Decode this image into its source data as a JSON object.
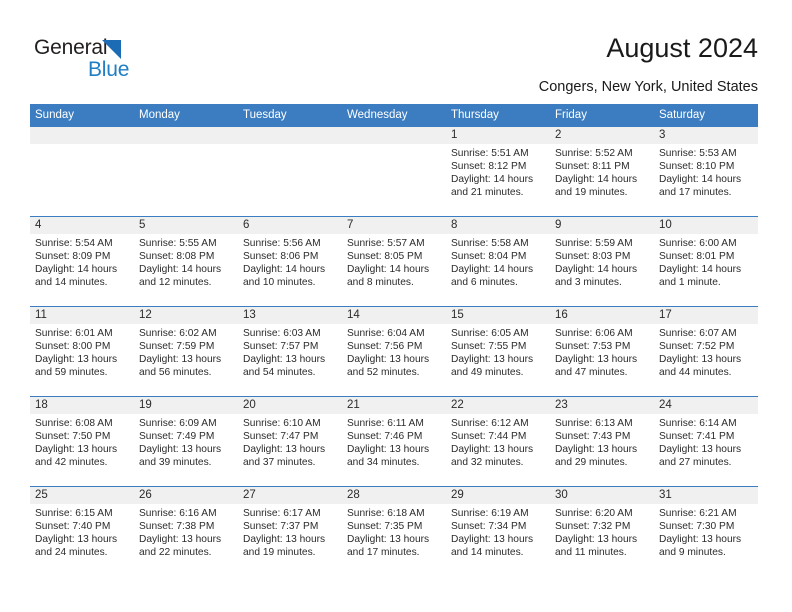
{
  "brand": {
    "name_part1": "General",
    "name_part2": "Blue",
    "triangle_color": "#1b6cb5",
    "blue_color": "#1f7ec4"
  },
  "header": {
    "title": "August 2024",
    "subtitle": "Congers, New York, United States"
  },
  "theme": {
    "header_bg": "#3b7dc0",
    "daynum_bg": "#f0f0f0",
    "grid_line": "#3b7dc0"
  },
  "calendar": {
    "weekday_headers": [
      "Sunday",
      "Monday",
      "Tuesday",
      "Wednesday",
      "Thursday",
      "Friday",
      "Saturday"
    ],
    "labels": {
      "sunrise": "Sunrise:",
      "sunset": "Sunset:",
      "daylight": "Daylight:"
    },
    "weeks": [
      [
        {
          "day": "",
          "empty": true
        },
        {
          "day": "",
          "empty": true
        },
        {
          "day": "",
          "empty": true
        },
        {
          "day": "",
          "empty": true
        },
        {
          "day": "1",
          "sunrise": "Sunrise: 5:51 AM",
          "sunset": "Sunset: 8:12 PM",
          "daylight": "Daylight: 14 hours and 21 minutes."
        },
        {
          "day": "2",
          "sunrise": "Sunrise: 5:52 AM",
          "sunset": "Sunset: 8:11 PM",
          "daylight": "Daylight: 14 hours and 19 minutes."
        },
        {
          "day": "3",
          "sunrise": "Sunrise: 5:53 AM",
          "sunset": "Sunset: 8:10 PM",
          "daylight": "Daylight: 14 hours and 17 minutes."
        }
      ],
      [
        {
          "day": "4",
          "sunrise": "Sunrise: 5:54 AM",
          "sunset": "Sunset: 8:09 PM",
          "daylight": "Daylight: 14 hours and 14 minutes."
        },
        {
          "day": "5",
          "sunrise": "Sunrise: 5:55 AM",
          "sunset": "Sunset: 8:08 PM",
          "daylight": "Daylight: 14 hours and 12 minutes."
        },
        {
          "day": "6",
          "sunrise": "Sunrise: 5:56 AM",
          "sunset": "Sunset: 8:06 PM",
          "daylight": "Daylight: 14 hours and 10 minutes."
        },
        {
          "day": "7",
          "sunrise": "Sunrise: 5:57 AM",
          "sunset": "Sunset: 8:05 PM",
          "daylight": "Daylight: 14 hours and 8 minutes."
        },
        {
          "day": "8",
          "sunrise": "Sunrise: 5:58 AM",
          "sunset": "Sunset: 8:04 PM",
          "daylight": "Daylight: 14 hours and 6 minutes."
        },
        {
          "day": "9",
          "sunrise": "Sunrise: 5:59 AM",
          "sunset": "Sunset: 8:03 PM",
          "daylight": "Daylight: 14 hours and 3 minutes."
        },
        {
          "day": "10",
          "sunrise": "Sunrise: 6:00 AM",
          "sunset": "Sunset: 8:01 PM",
          "daylight": "Daylight: 14 hours and 1 minute."
        }
      ],
      [
        {
          "day": "11",
          "sunrise": "Sunrise: 6:01 AM",
          "sunset": "Sunset: 8:00 PM",
          "daylight": "Daylight: 13 hours and 59 minutes."
        },
        {
          "day": "12",
          "sunrise": "Sunrise: 6:02 AM",
          "sunset": "Sunset: 7:59 PM",
          "daylight": "Daylight: 13 hours and 56 minutes."
        },
        {
          "day": "13",
          "sunrise": "Sunrise: 6:03 AM",
          "sunset": "Sunset: 7:57 PM",
          "daylight": "Daylight: 13 hours and 54 minutes."
        },
        {
          "day": "14",
          "sunrise": "Sunrise: 6:04 AM",
          "sunset": "Sunset: 7:56 PM",
          "daylight": "Daylight: 13 hours and 52 minutes."
        },
        {
          "day": "15",
          "sunrise": "Sunrise: 6:05 AM",
          "sunset": "Sunset: 7:55 PM",
          "daylight": "Daylight: 13 hours and 49 minutes."
        },
        {
          "day": "16",
          "sunrise": "Sunrise: 6:06 AM",
          "sunset": "Sunset: 7:53 PM",
          "daylight": "Daylight: 13 hours and 47 minutes."
        },
        {
          "day": "17",
          "sunrise": "Sunrise: 6:07 AM",
          "sunset": "Sunset: 7:52 PM",
          "daylight": "Daylight: 13 hours and 44 minutes."
        }
      ],
      [
        {
          "day": "18",
          "sunrise": "Sunrise: 6:08 AM",
          "sunset": "Sunset: 7:50 PM",
          "daylight": "Daylight: 13 hours and 42 minutes."
        },
        {
          "day": "19",
          "sunrise": "Sunrise: 6:09 AM",
          "sunset": "Sunset: 7:49 PM",
          "daylight": "Daylight: 13 hours and 39 minutes."
        },
        {
          "day": "20",
          "sunrise": "Sunrise: 6:10 AM",
          "sunset": "Sunset: 7:47 PM",
          "daylight": "Daylight: 13 hours and 37 minutes."
        },
        {
          "day": "21",
          "sunrise": "Sunrise: 6:11 AM",
          "sunset": "Sunset: 7:46 PM",
          "daylight": "Daylight: 13 hours and 34 minutes."
        },
        {
          "day": "22",
          "sunrise": "Sunrise: 6:12 AM",
          "sunset": "Sunset: 7:44 PM",
          "daylight": "Daylight: 13 hours and 32 minutes."
        },
        {
          "day": "23",
          "sunrise": "Sunrise: 6:13 AM",
          "sunset": "Sunset: 7:43 PM",
          "daylight": "Daylight: 13 hours and 29 minutes."
        },
        {
          "day": "24",
          "sunrise": "Sunrise: 6:14 AM",
          "sunset": "Sunset: 7:41 PM",
          "daylight": "Daylight: 13 hours and 27 minutes."
        }
      ],
      [
        {
          "day": "25",
          "sunrise": "Sunrise: 6:15 AM",
          "sunset": "Sunset: 7:40 PM",
          "daylight": "Daylight: 13 hours and 24 minutes."
        },
        {
          "day": "26",
          "sunrise": "Sunrise: 6:16 AM",
          "sunset": "Sunset: 7:38 PM",
          "daylight": "Daylight: 13 hours and 22 minutes."
        },
        {
          "day": "27",
          "sunrise": "Sunrise: 6:17 AM",
          "sunset": "Sunset: 7:37 PM",
          "daylight": "Daylight: 13 hours and 19 minutes."
        },
        {
          "day": "28",
          "sunrise": "Sunrise: 6:18 AM",
          "sunset": "Sunset: 7:35 PM",
          "daylight": "Daylight: 13 hours and 17 minutes."
        },
        {
          "day": "29",
          "sunrise": "Sunrise: 6:19 AM",
          "sunset": "Sunset: 7:34 PM",
          "daylight": "Daylight: 13 hours and 14 minutes."
        },
        {
          "day": "30",
          "sunrise": "Sunrise: 6:20 AM",
          "sunset": "Sunset: 7:32 PM",
          "daylight": "Daylight: 13 hours and 11 minutes."
        },
        {
          "day": "31",
          "sunrise": "Sunrise: 6:21 AM",
          "sunset": "Sunset: 7:30 PM",
          "daylight": "Daylight: 13 hours and 9 minutes."
        }
      ]
    ]
  }
}
